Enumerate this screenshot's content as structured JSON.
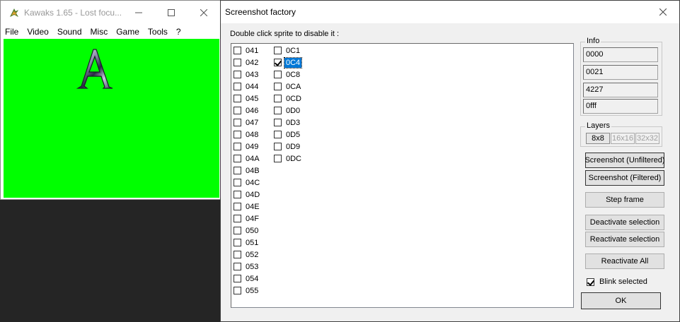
{
  "kawaks": {
    "title": "Kawaks 1.65 - Lost focu...",
    "menu": [
      "File",
      "Video",
      "Sound",
      "Misc",
      "Game",
      "Tools",
      "?"
    ],
    "screen_color": "#00ff00",
    "sprite_letter": "A"
  },
  "factory": {
    "title": "Screenshot factory",
    "instruction": "Double click sprite to disable it :",
    "sprites_col1": [
      "041",
      "042",
      "043",
      "044",
      "045",
      "046",
      "047",
      "048",
      "049",
      "04A",
      "04B",
      "04C",
      "04D",
      "04E",
      "04F",
      "050",
      "051",
      "052",
      "053",
      "054",
      "055"
    ],
    "sprites_col2": [
      {
        "label": "0C1",
        "checked": false,
        "selected": false
      },
      {
        "label": "0C4",
        "checked": true,
        "selected": true
      },
      {
        "label": "0C8",
        "checked": false,
        "selected": false
      },
      {
        "label": "0CA",
        "checked": false,
        "selected": false
      },
      {
        "label": "0CD",
        "checked": false,
        "selected": false
      },
      {
        "label": "0D0",
        "checked": false,
        "selected": false
      },
      {
        "label": "0D3",
        "checked": false,
        "selected": false
      },
      {
        "label": "0D5",
        "checked": false,
        "selected": false
      },
      {
        "label": "0D9",
        "checked": false,
        "selected": false
      },
      {
        "label": "0DC",
        "checked": false,
        "selected": false
      }
    ],
    "info": {
      "legend": "Info",
      "values": [
        "0000",
        "0021",
        "4227",
        "0fff"
      ]
    },
    "layers": {
      "legend": "Layers",
      "buttons": [
        {
          "label": "8x8",
          "enabled": true
        },
        {
          "label": "16x16",
          "enabled": false
        },
        {
          "label": "32x32",
          "enabled": false
        }
      ]
    },
    "buttons": {
      "screenshot_unfiltered": "Screenshot (Unfiltered)",
      "screenshot_filtered": "Screenshot (Filtered)",
      "step_frame": "Step frame",
      "deactivate_selection": "Deactivate selection",
      "reactivate_selection": "Reactivate selection",
      "reactivate_all": "Reactivate All",
      "ok": "OK"
    },
    "blink_selected": {
      "label": "Blink selected",
      "checked": true
    },
    "selection_color": "#0078d7"
  }
}
